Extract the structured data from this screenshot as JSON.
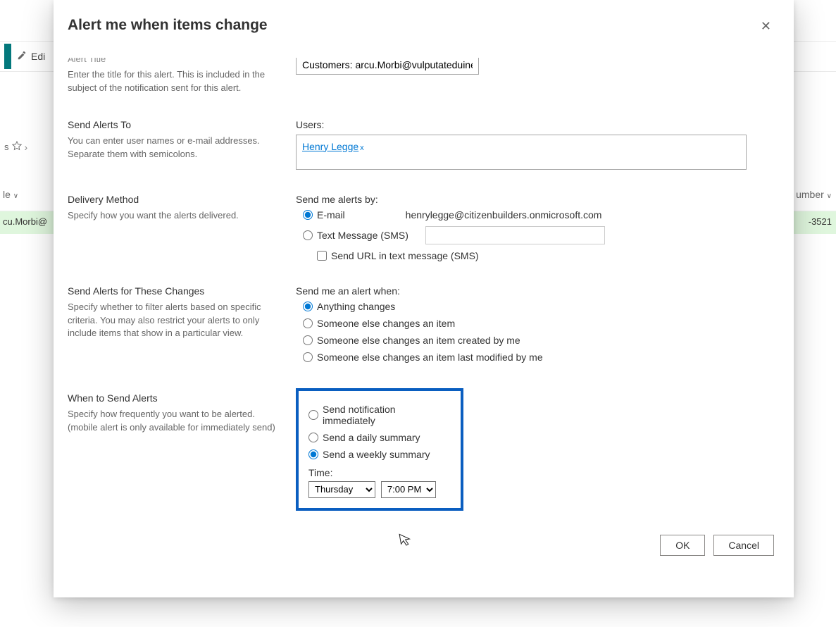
{
  "background": {
    "edit_label": "Edi",
    "pencil_icon": "pencil-icon",
    "star_icon": "star-icon",
    "chevron_icon": "chevron-right-icon",
    "col_left_fragment": "le",
    "col_right_fragment": "umber",
    "row_left_fragment": "cu.Morbi@",
    "row_right_fragment": "-3521"
  },
  "modal": {
    "title": "Alert me when items change",
    "close_label": "✕"
  },
  "alert_title": {
    "heading": "Alert Title",
    "description": "Enter the title for this alert. This is included in the subject of the notification sent for this alert.",
    "value": "Customers: arcu.Morbi@vulputateduinec."
  },
  "send_to": {
    "heading": "Send Alerts To",
    "description": "You can enter user names or e-mail addresses. Separate them with semicolons.",
    "field_label": "Users:",
    "user_chip": "Henry Legge",
    "chip_remove": "x"
  },
  "delivery": {
    "heading": "Delivery Method",
    "description": "Specify how you want the alerts delivered.",
    "field_label": "Send me alerts by:",
    "option_email": "E-mail",
    "email_address": "henrylegge@citizenbuilders.onmicrosoft.com",
    "option_sms": "Text Message (SMS)",
    "sms_placeholder": "",
    "send_url_label": "Send URL in text message (SMS)"
  },
  "changes": {
    "heading": "Send Alerts for These Changes",
    "description": "Specify whether to filter alerts based on specific criteria. You may also restrict your alerts to only include items that show in a particular view.",
    "field_label": "Send me an alert when:",
    "opt1": "Anything changes",
    "opt2": "Someone else changes an item",
    "opt3": "Someone else changes an item created by me",
    "opt4": "Someone else changes an item last modified by me"
  },
  "when": {
    "heading": "When to Send Alerts",
    "description": "Specify how frequently you want to be alerted. (mobile alert is only available for immediately send)",
    "opt1": "Send notification immediately",
    "opt2": "Send a daily summary",
    "opt3": "Send a weekly summary",
    "time_label": "Time:",
    "day_value": "Thursday",
    "hour_value": "7:00 PM"
  },
  "footer": {
    "ok": "OK",
    "cancel": "Cancel"
  }
}
